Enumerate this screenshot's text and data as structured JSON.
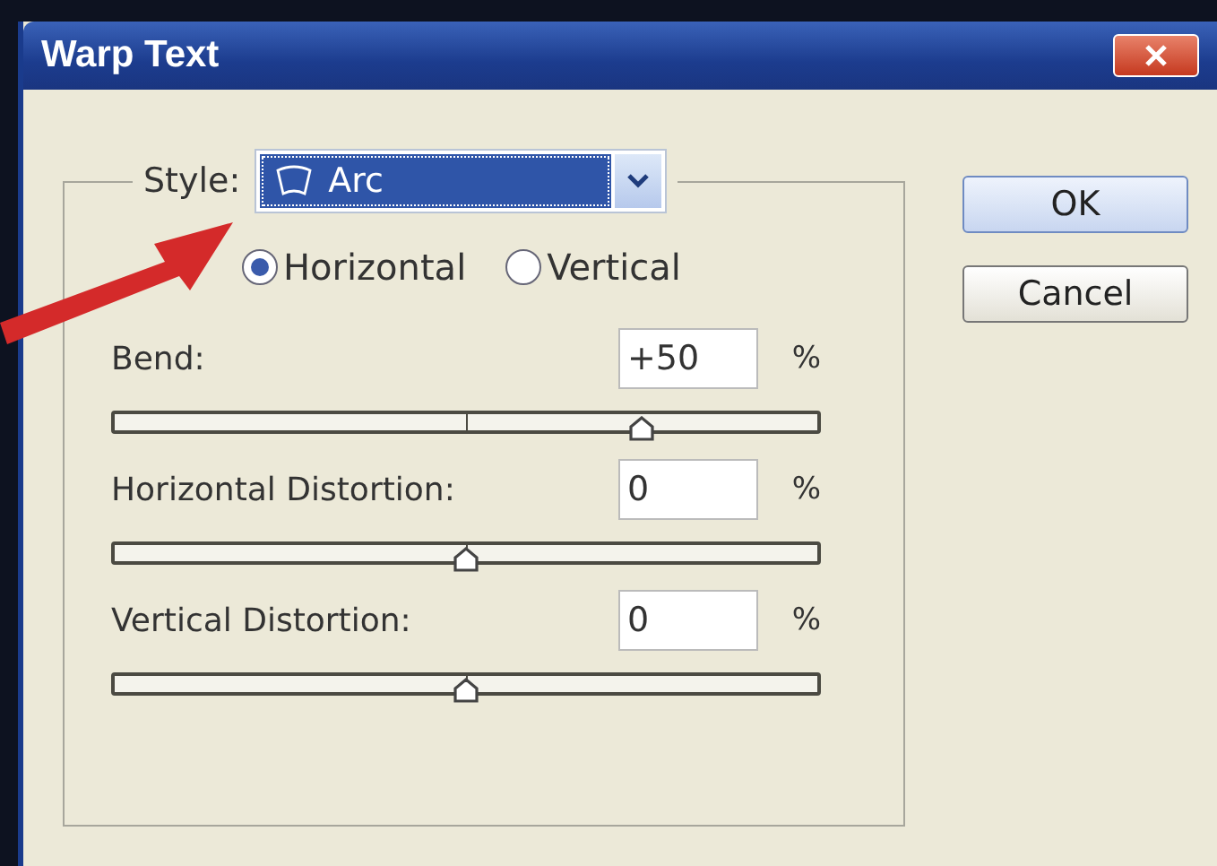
{
  "window": {
    "title": "Warp Text"
  },
  "style": {
    "label": "Style:",
    "value": "Arc"
  },
  "orientation": [
    {
      "label": "Horizontal",
      "selected": true
    },
    {
      "label": "Vertical",
      "selected": false
    }
  ],
  "sliders": [
    {
      "label": "Bend:",
      "value": "+50",
      "unit": "%",
      "level": 0.75
    },
    {
      "label": "Horizontal Distortion:",
      "value": "0",
      "unit": "%",
      "level": 0.5
    },
    {
      "label": "Vertical Distortion:",
      "value": "0",
      "unit": "%",
      "level": 0.5
    }
  ],
  "buttons": [
    "OK",
    "Cancel"
  ]
}
